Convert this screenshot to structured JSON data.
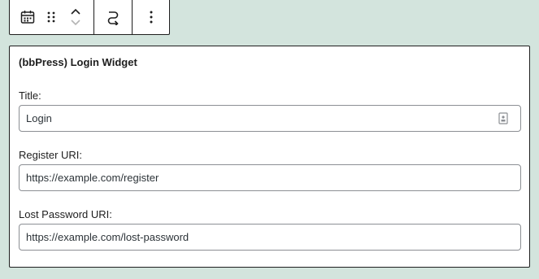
{
  "toolbar": {
    "block_icon": "calendar-icon",
    "drag_icon": "drag-handle-icon",
    "move_up_icon": "chevron-up-icon",
    "move_down_icon": "chevron-down-icon",
    "transform_icon": "transform-icon",
    "options_icon": "more-vertical-icon"
  },
  "widget": {
    "title": "(bbPress) Login Widget",
    "fields": [
      {
        "label": "Title:",
        "value": "Login"
      },
      {
        "label": "Register URI:",
        "value": "https://example.com/register"
      },
      {
        "label": "Lost Password URI:",
        "value": "https://example.com/lost-password"
      }
    ],
    "password_manager_icon": "password-manager-icon"
  },
  "colors": {
    "background": "#d3e4dd",
    "border": "#1e1e1e",
    "input_border": "#8c8f94"
  }
}
